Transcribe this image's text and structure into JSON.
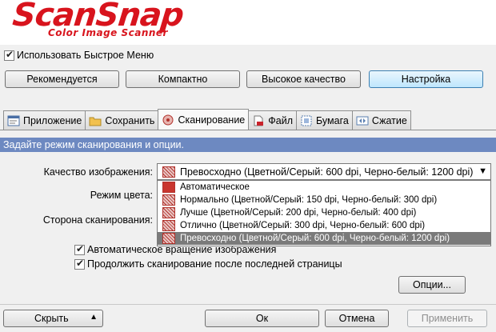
{
  "logo": {
    "brand": "ScanSnap",
    "tagline": "Color Image Scanner"
  },
  "quick_menu": {
    "label": "Использовать Быстрое Меню",
    "checked": true
  },
  "presets": {
    "recommended": "Рекомендуется",
    "compact": "Компактно",
    "high_quality": "Высокое качество",
    "custom": "Настройка"
  },
  "tabs": [
    {
      "label": "Приложение",
      "icon": "application-icon"
    },
    {
      "label": "Сохранить",
      "icon": "save-folder-icon"
    },
    {
      "label": "Сканирование",
      "icon": "scan-icon",
      "active": true
    },
    {
      "label": "Файл",
      "icon": "file-icon"
    },
    {
      "label": "Бумага",
      "icon": "paper-icon"
    },
    {
      "label": "Сжатие",
      "icon": "compression-icon"
    }
  ],
  "banner": "Задайте режим сканирования и опции.",
  "form": {
    "image_quality_label": "Качество изображения:",
    "image_quality_value": "Превосходно (Цветной/Серый: 600 dpi, Черно-белый: 1200 dpi)",
    "color_mode_label": "Режим цвета:",
    "scan_side_label": "Сторона сканирования:",
    "auto_rotate_label": "Автоматическое вращение изображения",
    "auto_rotate_checked": true,
    "continue_label": "Продолжить сканирование после последней страницы",
    "continue_checked": true,
    "options_button": "Опции..."
  },
  "quality_options": [
    "Автоматическое",
    "Нормально (Цветной/Серый: 150 dpi, Черно-белый: 300 dpi)",
    "Лучше (Цветной/Серый: 200 dpi, Черно-белый: 400 dpi)",
    "Отлично (Цветной/Серый: 300 dpi, Черно-белый: 600 dpi)",
    "Превосходно (Цветной/Серый: 600 dpi, Черно-белый: 1200 dpi)"
  ],
  "footer": {
    "hide": "Скрыть",
    "ok": "Ок",
    "cancel": "Отмена",
    "apply": "Применить"
  },
  "colors": {
    "brand_red": "#d8141d",
    "banner_blue": "#6d89c1",
    "selected_item": "#7a7a7a"
  }
}
